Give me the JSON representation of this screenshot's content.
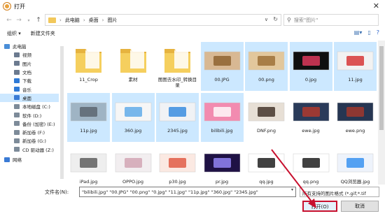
{
  "window": {
    "title": "打开"
  },
  "breadcrumb": [
    "此电脑",
    "桌面",
    "图片"
  ],
  "search": {
    "placeholder": "搜索\"图片\""
  },
  "toolbar": {
    "organize": "组织 ▾",
    "new_folder": "新建文件夹"
  },
  "sidebar": {
    "items": [
      {
        "label": "此电脑",
        "icon": "computer-icon",
        "color": "#4a8ed8",
        "level": "top"
      },
      {
        "label": "视频",
        "icon": "video-icon",
        "color": "#6b7a8f",
        "level": "child"
      },
      {
        "label": "图片",
        "icon": "pictures-icon",
        "color": "#6b7a8f",
        "level": "child"
      },
      {
        "label": "文档",
        "icon": "document-icon",
        "color": "#6b7a8f",
        "level": "child"
      },
      {
        "label": "下载",
        "icon": "download-icon",
        "color": "#2f7ad6",
        "level": "child"
      },
      {
        "label": "音乐",
        "icon": "music-icon",
        "color": "#2f7ad6",
        "level": "child"
      },
      {
        "label": "桌面",
        "icon": "desktop-icon",
        "color": "#3a7bd5",
        "level": "child",
        "selected": true
      },
      {
        "label": "本地磁盘 (C:)",
        "icon": "disk-icon",
        "color": "#7d8b99",
        "level": "child"
      },
      {
        "label": "软件 (D:)",
        "icon": "disk-icon",
        "color": "#7d8b99",
        "level": "child"
      },
      {
        "label": "备份 (加密) (E:)",
        "icon": "disk-icon",
        "color": "#7d8b99",
        "level": "child"
      },
      {
        "label": "新加卷 (F:)",
        "icon": "disk-icon",
        "color": "#7d8b99",
        "level": "child"
      },
      {
        "label": "新加卷 (G:)",
        "icon": "disk-icon",
        "color": "#7d8b99",
        "level": "child"
      },
      {
        "label": "CD 驱动器 (Z:)",
        "icon": "cd-icon",
        "color": "#7d8b99",
        "level": "child"
      },
      {
        "label": "网络",
        "icon": "network-icon",
        "color": "#3a7bd5",
        "level": "top"
      }
    ]
  },
  "files": [
    {
      "name": "11_Crop",
      "kind": "folder",
      "selected": false
    },
    {
      "name": "素材",
      "kind": "folder",
      "selected": false
    },
    {
      "name": "图图去水印_转换目录",
      "kind": "folder",
      "selected": false
    },
    {
      "name": "00.JPG",
      "kind": "image",
      "selected": true,
      "colors": [
        "#d8b893",
        "#8b5e2b"
      ]
    },
    {
      "name": "00.png",
      "kind": "image",
      "selected": true,
      "colors": [
        "#e2c79c",
        "#9a6b32"
      ]
    },
    {
      "name": "0.jpg",
      "kind": "image",
      "selected": true,
      "colors": [
        "#0f0f0f",
        "#e93b5f"
      ]
    },
    {
      "name": "11.jpg",
      "kind": "image",
      "selected": true,
      "colors": [
        "#f2f2f2",
        "#d52b2b"
      ]
    },
    {
      "name": "11p.jpg",
      "kind": "image",
      "selected": true,
      "colors": [
        "#9fb4c4",
        "#58626b"
      ]
    },
    {
      "name": "360.jpg",
      "kind": "image",
      "selected": true,
      "colors": [
        "#f6f6f6",
        "#59a8e8"
      ]
    },
    {
      "name": "2345.jpg",
      "kind": "image",
      "selected": true,
      "colors": [
        "#f0f2f5",
        "#2e86de"
      ]
    },
    {
      "name": "bilibili.jpg",
      "kind": "image",
      "selected": true,
      "colors": [
        "#f28bb0",
        "#ffffff"
      ]
    },
    {
      "name": "DNF.png",
      "kind": "image",
      "selected": false,
      "colors": [
        "#e7dfd5",
        "#3b2a20"
      ]
    },
    {
      "name": "ewe.jpg",
      "kind": "image",
      "selected": false,
      "colors": [
        "#2a3b5a",
        "#b83a2a"
      ]
    },
    {
      "name": "ewe.png",
      "kind": "image",
      "selected": false,
      "colors": [
        "#263652",
        "#a9382b"
      ]
    },
    {
      "name": "iPad.jpg",
      "kind": "image",
      "selected": false,
      "colors": [
        "#eeeeee",
        "#555555"
      ]
    },
    {
      "name": "OPPO.jpg",
      "kind": "image",
      "selected": false,
      "colors": [
        "#f2eef0",
        "#cfa0b0"
      ]
    },
    {
      "name": "p30.jpg",
      "kind": "image",
      "selected": false,
      "colors": [
        "#fbe9e2",
        "#e0523c"
      ]
    },
    {
      "name": "pr.jpg",
      "kind": "image",
      "selected": false,
      "colors": [
        "#1f1245",
        "#9a8cff"
      ]
    },
    {
      "name": "qq.jpg",
      "kind": "image",
      "selected": false,
      "colors": [
        "#ffffff",
        "#111111"
      ]
    },
    {
      "name": "qq.png",
      "kind": "image",
      "selected": false,
      "colors": [
        "#ffffff",
        "#111111"
      ]
    },
    {
      "name": "QQ浏览器.jpg",
      "kind": "image",
      "selected": false,
      "colors": [
        "#eef3fb",
        "#2d8cf0"
      ]
    }
  ],
  "filename_field": {
    "label": "文件名(N):",
    "value": "\"bilibili.jpg\" \"00.JPG\" \"00.png\" \"0.jpg\" \"11.jpg\" \"11p.jpg\" \"360.jpg\" \"2345.jpg\""
  },
  "filetype_filter": {
    "value": "所有支持的图片格式 (*.gif;*.tif"
  },
  "buttons": {
    "open": "打开(O)",
    "cancel": "取消"
  },
  "colors": {
    "selection": "#cce8ff",
    "highlight_border": "#c8102e",
    "folder": "#f2c85b"
  }
}
